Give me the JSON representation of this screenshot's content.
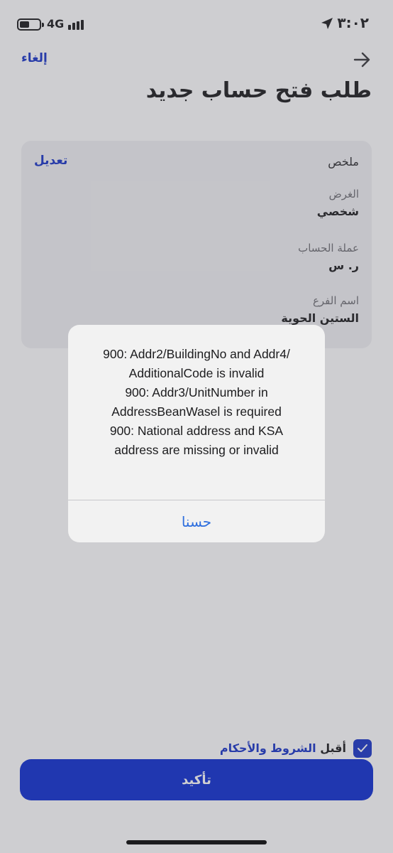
{
  "status_bar": {
    "network": "4G",
    "time": "٣:٠٢",
    "battery_icon": "battery-icon",
    "signal_icon": "signal-bars-icon",
    "location_icon": "location-arrow-icon"
  },
  "header": {
    "cancel_label": "إلغاء",
    "title": "طلب فتح حساب جديد",
    "back_icon": "arrow-right-icon"
  },
  "summary": {
    "title": "ملخص",
    "edit_label": "تعديل",
    "fields": [
      {
        "label": "الغرض",
        "value": "شخصي"
      },
      {
        "label": "عملة الحساب",
        "value": "ر. س"
      },
      {
        "label": "اسم الفرع",
        "value": "الستين الحوية"
      }
    ]
  },
  "terms": {
    "checked": true,
    "prefix": "أقبل ",
    "link": "الشروط والأحكام"
  },
  "confirm_label": "تأكيد",
  "alert": {
    "message": "900: Addr2/BuildingNo and Addr4/\nAdditionalCode is invalid\n900: Addr3/UnitNumber in\nAddressBeanWasel is required\n900: National address and KSA\naddress are missing or invalid",
    "ok_label": "حسنا"
  },
  "colors": {
    "accent": "#1a35c8",
    "button": "#0f2ed1",
    "alert_action": "#2f6fde"
  }
}
